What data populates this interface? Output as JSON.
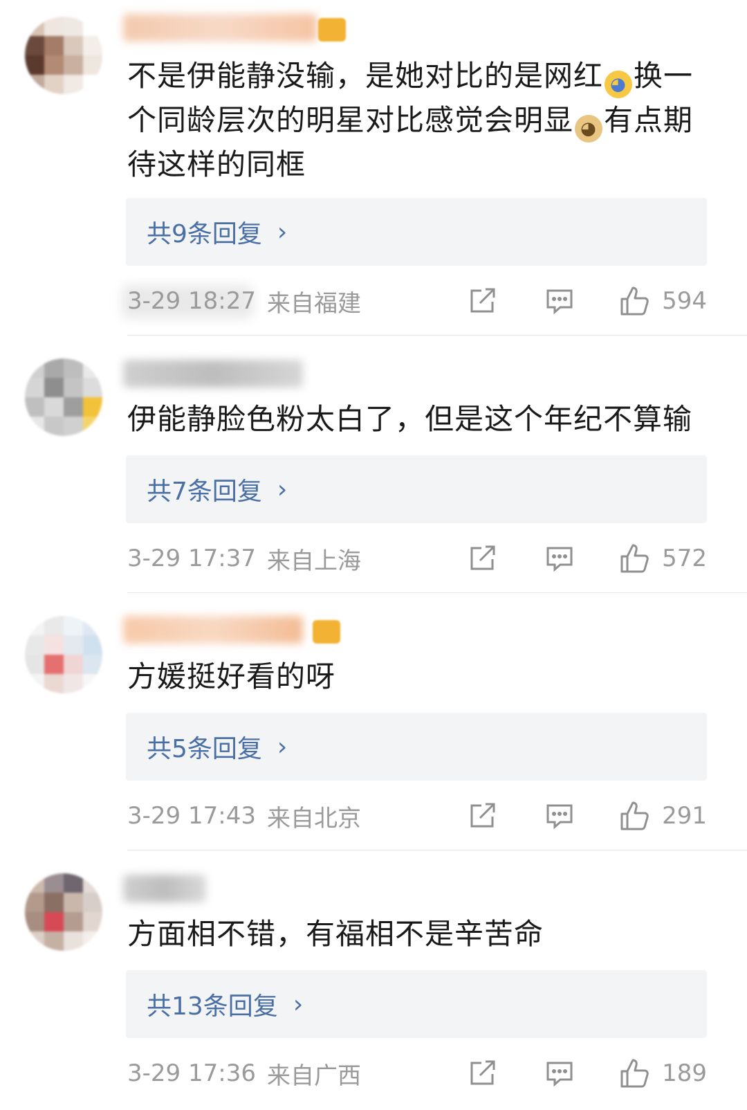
{
  "comments": [
    {
      "text_parts": [
        "不是伊能静没输，是她对比的是网红",
        "换一个同龄层次的明星对比感觉会明显",
        "有点期待这样的同框"
      ],
      "emojis": [
        "cry-laugh-emoji",
        "doge-emoji"
      ],
      "replies_label": "共9条回复",
      "time": "3-29 18:27",
      "location": "来自福建",
      "likes": "594"
    },
    {
      "text": "伊能静脸色粉太白了，但是这个年纪不算输",
      "replies_label": "共7条回复",
      "time": "3-29 17:37",
      "location": "来自上海",
      "likes": "572"
    },
    {
      "text": "方媛挺好看的呀",
      "replies_label": "共5条回复",
      "time": "3-29 17:43",
      "location": "来自北京",
      "likes": "291"
    },
    {
      "text": "方面相不错，有福相不是辛苦命",
      "replies_label": "共13条回复",
      "time": "3-29 17:36",
      "location": "来自广西",
      "likes": "189"
    }
  ],
  "icons": {
    "chevron": "chevron-right-icon",
    "share": "share-icon",
    "comment": "comment-icon",
    "like": "thumbs-up-icon"
  },
  "colors": {
    "reply_link": "#4a6fa5",
    "meta_text": "#9a9a9a",
    "reply_box_bg": "#f3f4f6"
  }
}
